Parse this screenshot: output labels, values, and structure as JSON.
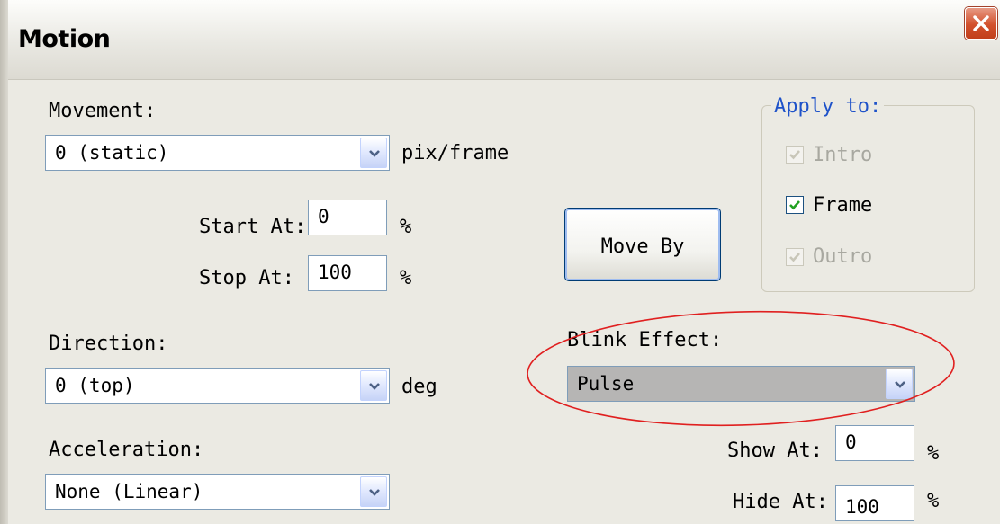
{
  "window": {
    "title": "Motion"
  },
  "movement": {
    "label": "Movement:",
    "value": "0 (static)",
    "unit": "pix/frame"
  },
  "start_at": {
    "label": "Start At:",
    "value": "0",
    "unit": "%"
  },
  "stop_at": {
    "label": "Stop At:",
    "value": "100",
    "unit": "%"
  },
  "move_by_button": {
    "label": "Move By"
  },
  "apply_to": {
    "title": "Apply to:",
    "intro": {
      "label": "Intro",
      "checked": true,
      "enabled": false
    },
    "frame": {
      "label": "Frame",
      "checked": true,
      "enabled": true
    },
    "outro": {
      "label": "Outro",
      "checked": true,
      "enabled": false
    }
  },
  "direction": {
    "label": "Direction:",
    "value": "0 (top)",
    "unit": "deg"
  },
  "blink_effect": {
    "label": "Blink Effect:",
    "value": "Pulse"
  },
  "acceleration": {
    "label": "Acceleration:",
    "value": "None (Linear)"
  },
  "show_at": {
    "label": "Show At:",
    "value": "0",
    "unit": "%"
  },
  "hide_at": {
    "label": "Hide At:",
    "value": "100",
    "unit": "%"
  },
  "colors": {
    "annotation": "#e02020",
    "checkmark": "#21a121",
    "accent_label": "#1e52c9"
  },
  "icons": {
    "close": "close-icon",
    "dropdown": "chevron-down-icon",
    "check": "check-icon"
  }
}
